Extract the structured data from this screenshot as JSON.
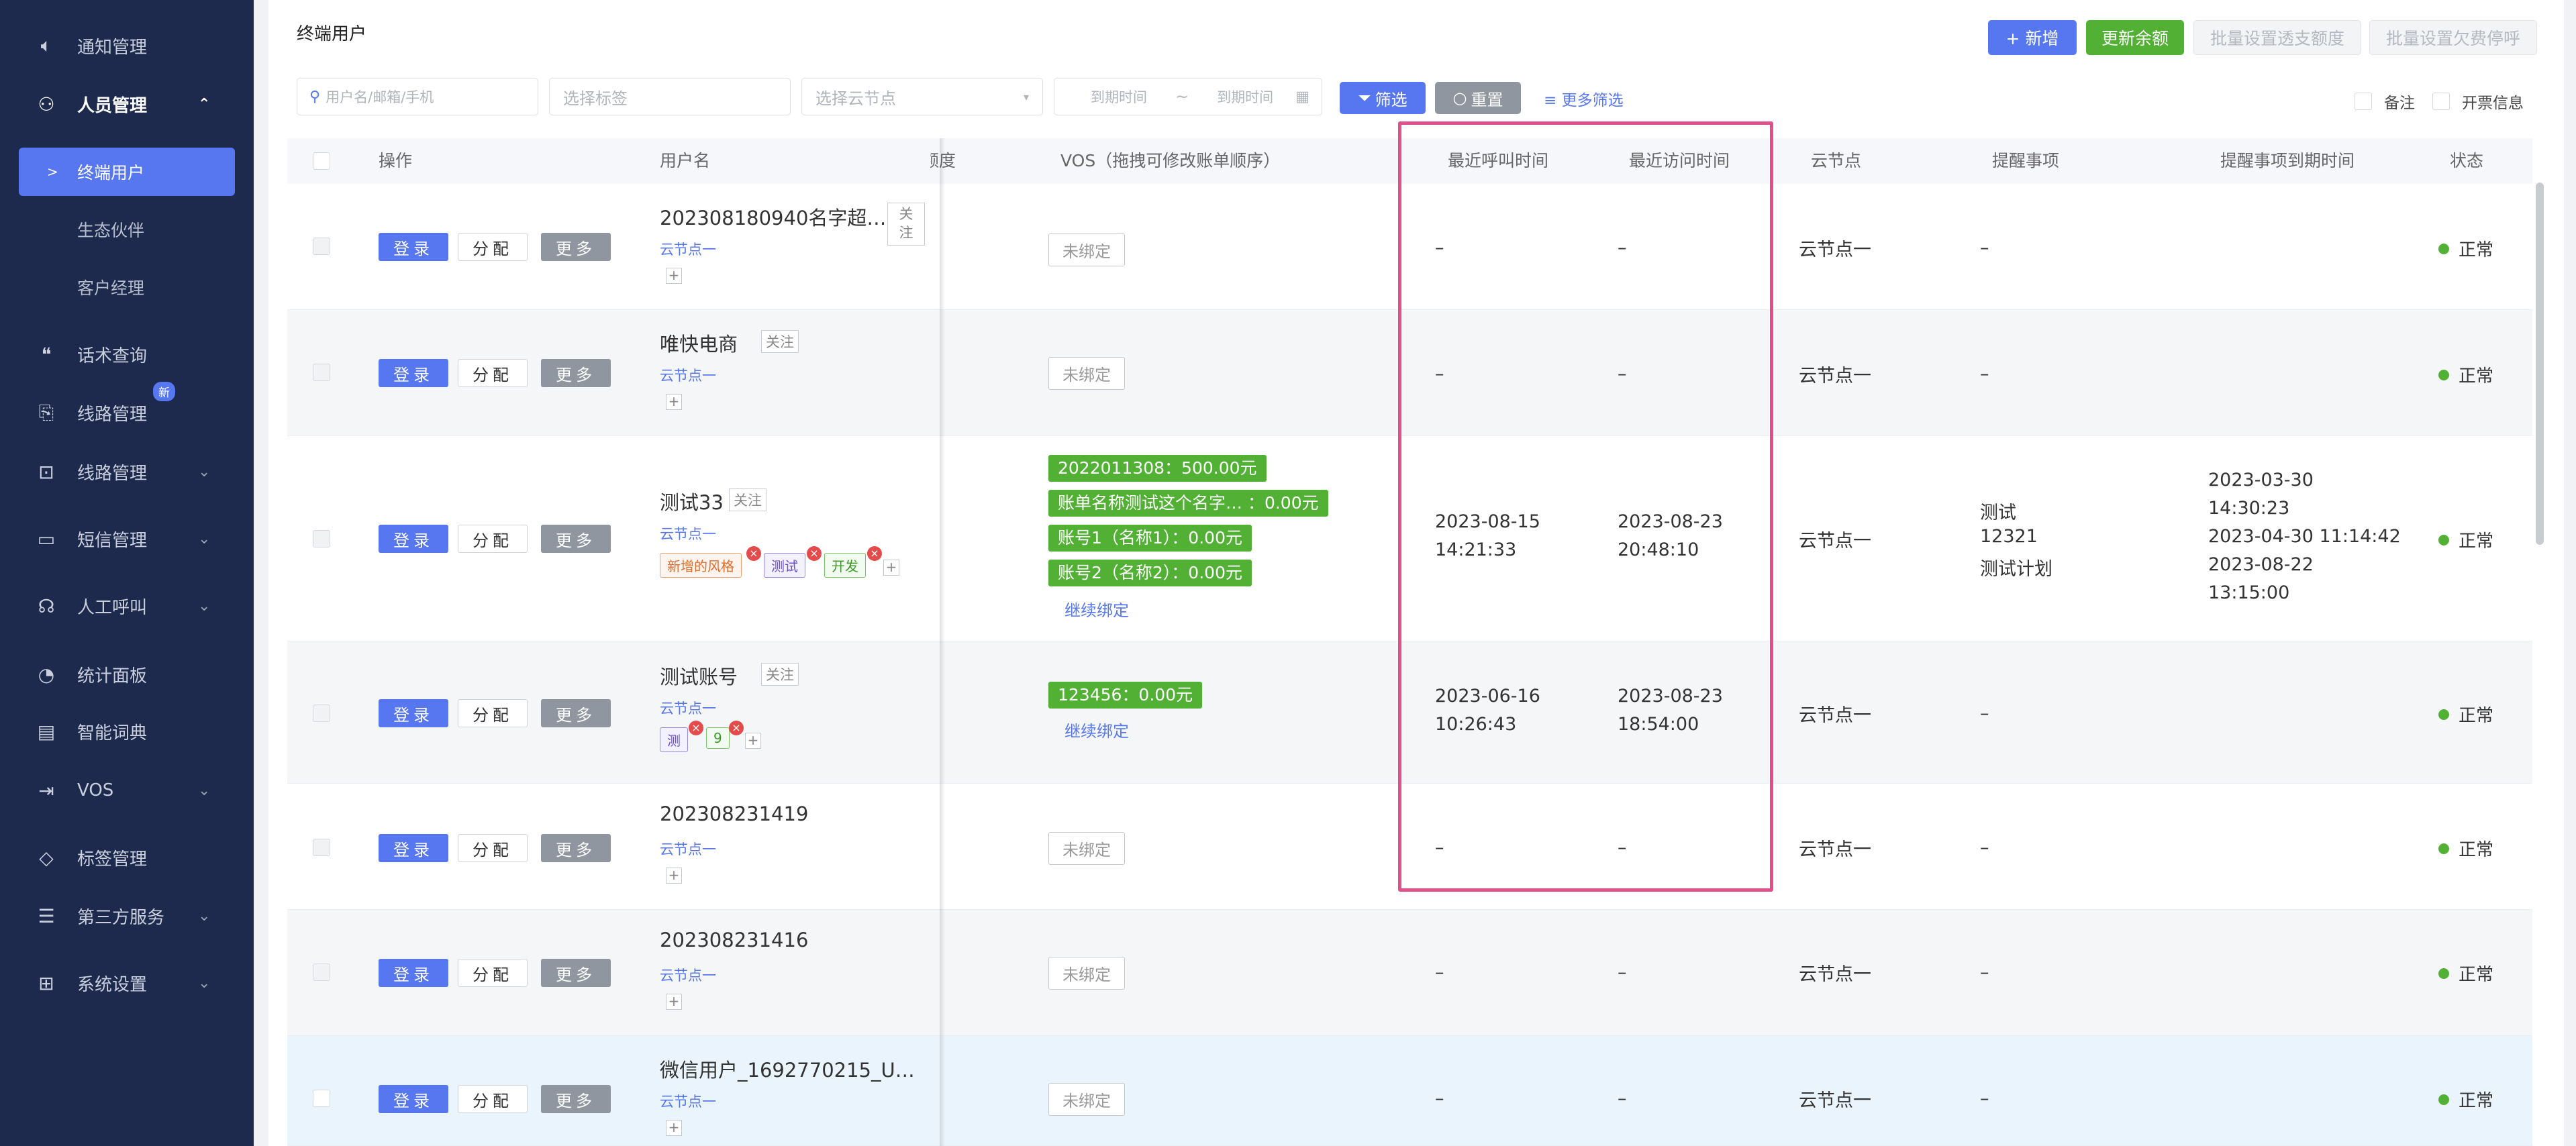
{
  "sidebar": {
    "items": [
      {
        "label": "通知管理",
        "icon": "speaker-icon"
      },
      {
        "label": "人员管理",
        "icon": "users-icon"
      },
      {
        "label": "话术查询",
        "icon": "quote-icon"
      },
      {
        "label": "线路管理",
        "icon": "route-icon",
        "badge": "新"
      },
      {
        "label": "线路管理",
        "icon": "route-chart-icon"
      },
      {
        "label": "短信管理",
        "icon": "sms-icon"
      },
      {
        "label": "人工呼叫",
        "icon": "headset-icon"
      },
      {
        "label": "统计面板",
        "icon": "pie-chart-icon"
      },
      {
        "label": "智能词典",
        "icon": "dictionary-icon"
      },
      {
        "label": "VOS",
        "icon": "vos-icon"
      },
      {
        "label": "标签管理",
        "icon": "tag-icon"
      },
      {
        "label": "第三方服务",
        "icon": "server-icon"
      },
      {
        "label": "系统设置",
        "icon": "grid-icon"
      }
    ],
    "sub_items": [
      "终端用户",
      "生态伙伴",
      "客户经理"
    ]
  },
  "header": {
    "title": "终端用户",
    "buttons": {
      "add": "+ 新增",
      "update_balance": "更新余额",
      "batch_overdraft": "批量设置透支额度",
      "batch_stop": "批量设置欠费停呼"
    }
  },
  "filters": {
    "user_placeholder": "用户名/邮箱/手机",
    "tag_placeholder": "选择标签",
    "node_placeholder": "选择云节点",
    "date_start": "到期时间",
    "date_sep": "~",
    "date_end": "到期时间",
    "filter_btn": "筛选",
    "reset_btn": "重置",
    "more_filter": "更多筛选",
    "remark": "备注",
    "invoice": "开票信息"
  },
  "table": {
    "headers": {
      "op": "操作",
      "username": "用户名",
      "quota": "额度",
      "vos": "VOS（拖拽可修改账单顺序）",
      "last_call": "最近呼叫时间",
      "last_visit": "最近访问时间",
      "node": "云节点",
      "reminder": "提醒事项",
      "reminder_due": "提醒事项到期时间",
      "status": "状态"
    },
    "actions": {
      "login": "登录",
      "assign": "分配",
      "more": "更多"
    },
    "follow_label": "关注",
    "unbound_label": "未绑定",
    "continue_bind": "继续绑定",
    "rows": [
      {
        "username": "202308180940名字超…",
        "node_link": "云节点一",
        "last_call": "–",
        "last_visit": "–",
        "node": "云节点一",
        "reminder": "–",
        "status": "正常"
      },
      {
        "username": "唯快电商",
        "node_link": "云节点一",
        "last_call": "–",
        "last_visit": "–",
        "node": "云节点一",
        "reminder": "–",
        "status": "正常"
      },
      {
        "username": "测试33",
        "node_link": "云节点一",
        "tags": [
          "新增的风格",
          "测试",
          "开发"
        ],
        "vos_tags": [
          "2022011308：500.00元",
          "账单名称测试这个名字… ：0.00元",
          "账号1（名称1）：0.00元",
          "账号2（名称2）：0.00元"
        ],
        "last_call_1": "2023-08-15",
        "last_call_2": "14:21:33",
        "last_visit_1": "2023-08-23",
        "last_visit_2": "20:48:10",
        "node": "云节点一",
        "reminder_1": "测试",
        "reminder_2": "12321",
        "reminder_3": "测试计划",
        "due_1": "2023-03-30",
        "due_2": "14:30:23",
        "due_3": "2023-04-30 11:14:42",
        "due_4": "2023-08-22",
        "due_5": "13:15:00",
        "status": "正常"
      },
      {
        "username": "测试账号",
        "node_link": "云节点一",
        "tags": [
          "测",
          "9"
        ],
        "vos_tags": [
          "123456：0.00元"
        ],
        "last_call_1": "2023-06-16",
        "last_call_2": "10:26:43",
        "last_visit_1": "2023-08-23",
        "last_visit_2": "18:54:00",
        "node": "云节点一",
        "reminder": "–",
        "status": "正常"
      },
      {
        "username": "202308231419",
        "node_link": "云节点一",
        "last_call": "–",
        "last_visit": "–",
        "node": "云节点一",
        "reminder": "–",
        "status": "正常"
      },
      {
        "username": "202308231416",
        "node_link": "云节点一",
        "last_call": "–",
        "last_visit": "–",
        "node": "云节点一",
        "reminder": "–",
        "status": "正常"
      },
      {
        "username": "微信用户_1692770215_U…",
        "node_link": "云节点一",
        "last_call": "–",
        "last_visit": "–",
        "node": "云节点一",
        "reminder": "–",
        "status": "正常"
      }
    ]
  },
  "colors": {
    "sidebar_bg": "#1d2a4d",
    "accent": "#5677f0",
    "green": "#52b135",
    "highlight": "#e0508a"
  }
}
